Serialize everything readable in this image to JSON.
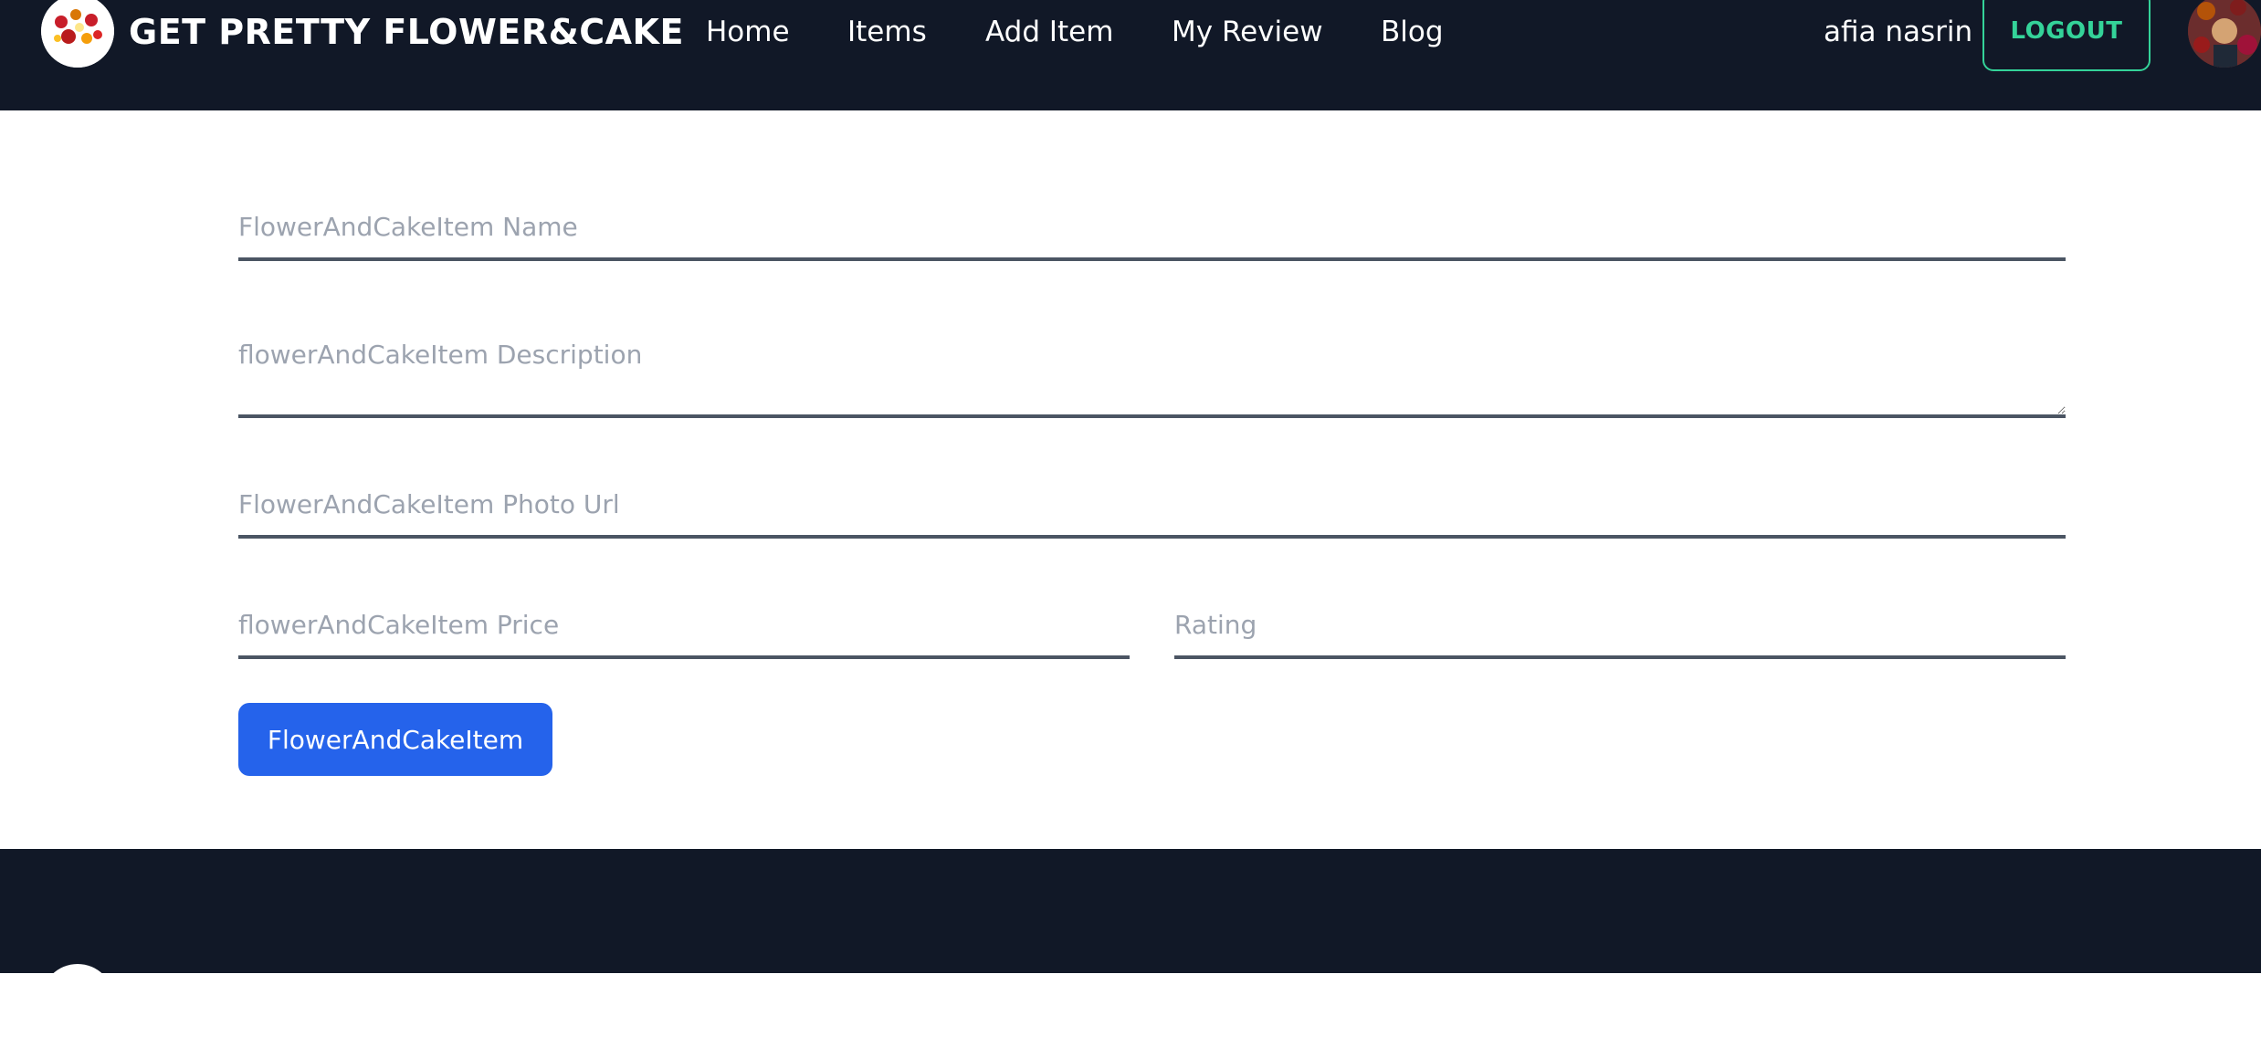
{
  "header": {
    "brand": "GET PRETTY FLOWER&CAKE",
    "nav_links": [
      {
        "label": "Home"
      },
      {
        "label": "Items"
      },
      {
        "label": "Add Item"
      },
      {
        "label": "My Review"
      },
      {
        "label": "Blog"
      }
    ],
    "username": "afia nasrin",
    "logout_label": "LOGOUT",
    "logo_icon": "flower-cake-logo-icon",
    "avatar_icon": "user-avatar"
  },
  "form": {
    "name_placeholder": "FlowerAndCakeItem Name",
    "description_placeholder": "flowerAndCakeItem Description",
    "photo_placeholder": "FlowerAndCakeItem Photo Url",
    "price_placeholder": "flowerAndCakeItem Price",
    "rating_placeholder": "Rating",
    "submit_label": "FlowerAndCakeItem"
  },
  "colors": {
    "nav_bg": "#111827",
    "accent_green": "#34d399",
    "button_blue": "#2563eb",
    "input_border": "#4b5563",
    "placeholder": "#9ca3af"
  }
}
